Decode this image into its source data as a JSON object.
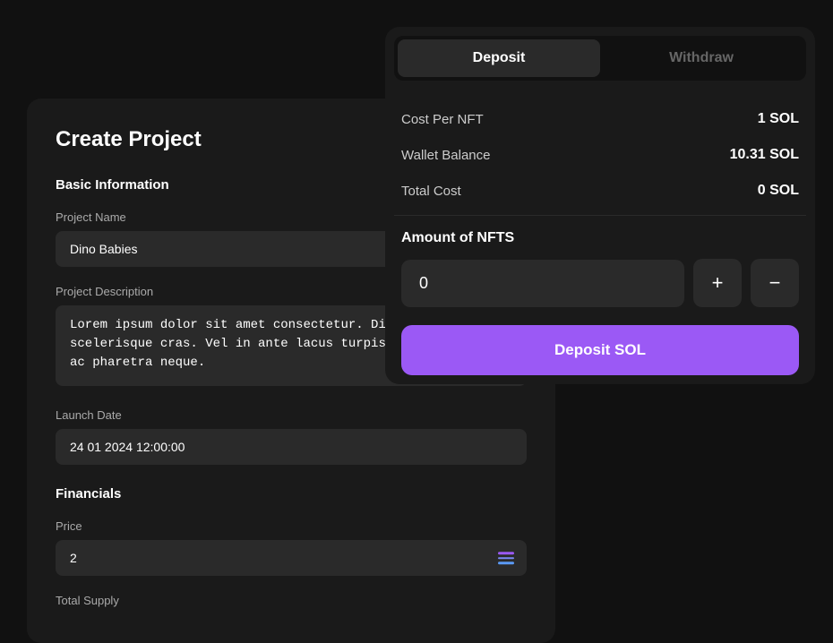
{
  "createProject": {
    "title": "Create Project",
    "basicInfo": {
      "sectionTitle": "Basic Information",
      "projectNameLabel": "Project Name",
      "projectNameValue": "Dino Babies",
      "projectDescriptionLabel": "Project Description",
      "projectDescriptionValue": "Lorem ipsum dolor sit amet consectetur. Diam vari scelerisque cras. Vel in ante lacus turpis tristique ris ac pharetra neque.",
      "launchDateLabel": "Launch Date",
      "launchDateValue": "24 01 2024 12:00:00"
    },
    "financials": {
      "sectionTitle": "Financials",
      "priceLabel": "Price",
      "priceValue": "2",
      "totalSupplyLabel": "Total Supply"
    }
  },
  "depositWidget": {
    "tabs": [
      {
        "label": "Deposit",
        "active": true
      },
      {
        "label": "Withdraw",
        "active": false
      }
    ],
    "costPerNFTLabel": "Cost Per NFT",
    "costPerNFTValue": "1 SOL",
    "walletBalanceLabel": "Wallet Balance",
    "walletBalanceValue": "10.31 SOL",
    "totalCostLabel": "Total Cost",
    "totalCostValue": "0 SOL",
    "amountLabel": "Amount of NFTS",
    "amountValue": "0",
    "depositBtnLabel": "Deposit SOL",
    "plusLabel": "+",
    "minusLabel": "−"
  }
}
